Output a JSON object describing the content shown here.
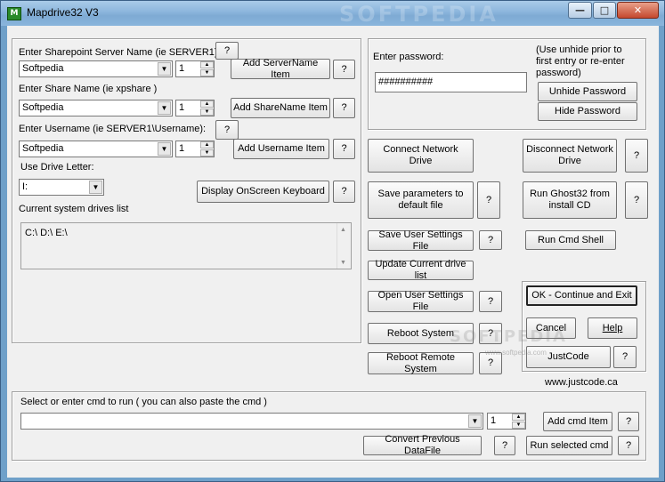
{
  "window": {
    "title": "Mapdrive32 V3",
    "icon_text": "M",
    "watermark": "SOFTPEDIA"
  },
  "controls": {
    "minimize": "—",
    "maximize": "□",
    "close": "✕"
  },
  "sharepoint": {
    "label": "Enter Sharepoint Server Name (ie SERVER1):",
    "help": "?",
    "value": "Softpedia",
    "count": "1",
    "add_label": "Add ServerName Item",
    "q": "?"
  },
  "share": {
    "label": "Enter Share Name (ie xpshare )",
    "value": "Softpedia",
    "count": "1",
    "add_label": "Add ShareName Item",
    "q": "?"
  },
  "username": {
    "label": "Enter Username (ie SERVER1\\Username):",
    "help": "?",
    "value": "Softpedia",
    "count": "1",
    "add_label": "Add Username Item",
    "q": "?"
  },
  "drive_letter": {
    "label": "Use Drive Letter:",
    "value": "I:"
  },
  "keyboard": {
    "label": "Display OnScreen Keyboard",
    "q": "?"
  },
  "drives": {
    "label": "Current system drives list",
    "value": "C:\\ D:\\ E:\\"
  },
  "password": {
    "label": "Enter password:",
    "value": "##########",
    "note": "(Use unhide prior to first entry  or re-enter password)",
    "unhide": "Unhide Password",
    "hide": "Hide Password"
  },
  "actions": {
    "connect": "Connect Network Drive",
    "disconnect": "Disconnect Network Drive",
    "save_params": "Save parameters to default file",
    "run_ghost": "Run Ghost32 from install CD",
    "save_user": "Save User Settings File",
    "run_cmd_shell": "Run Cmd Shell",
    "update_drives": "Update Current drive list",
    "open_user": "Open User Settings File",
    "reboot": "Reboot System",
    "reboot_remote": "Reboot Remote System",
    "q": "?"
  },
  "exit_group": {
    "ok": "OK - Continue and Exit",
    "cancel": "Cancel",
    "help": "Help",
    "justcode": "JustCode",
    "q": "?"
  },
  "website": "www.justcode.ca",
  "cmd": {
    "label": "Select or enter cmd to run ( you can also paste the cmd )",
    "value": "",
    "count": "1",
    "add": "Add cmd Item",
    "convert": "Convert Previous DataFile",
    "run": "Run selected cmd",
    "q": "?"
  },
  "softpedia_mark": "SOFTPEDIA",
  "softpedia_url": "www.softpedia.com"
}
